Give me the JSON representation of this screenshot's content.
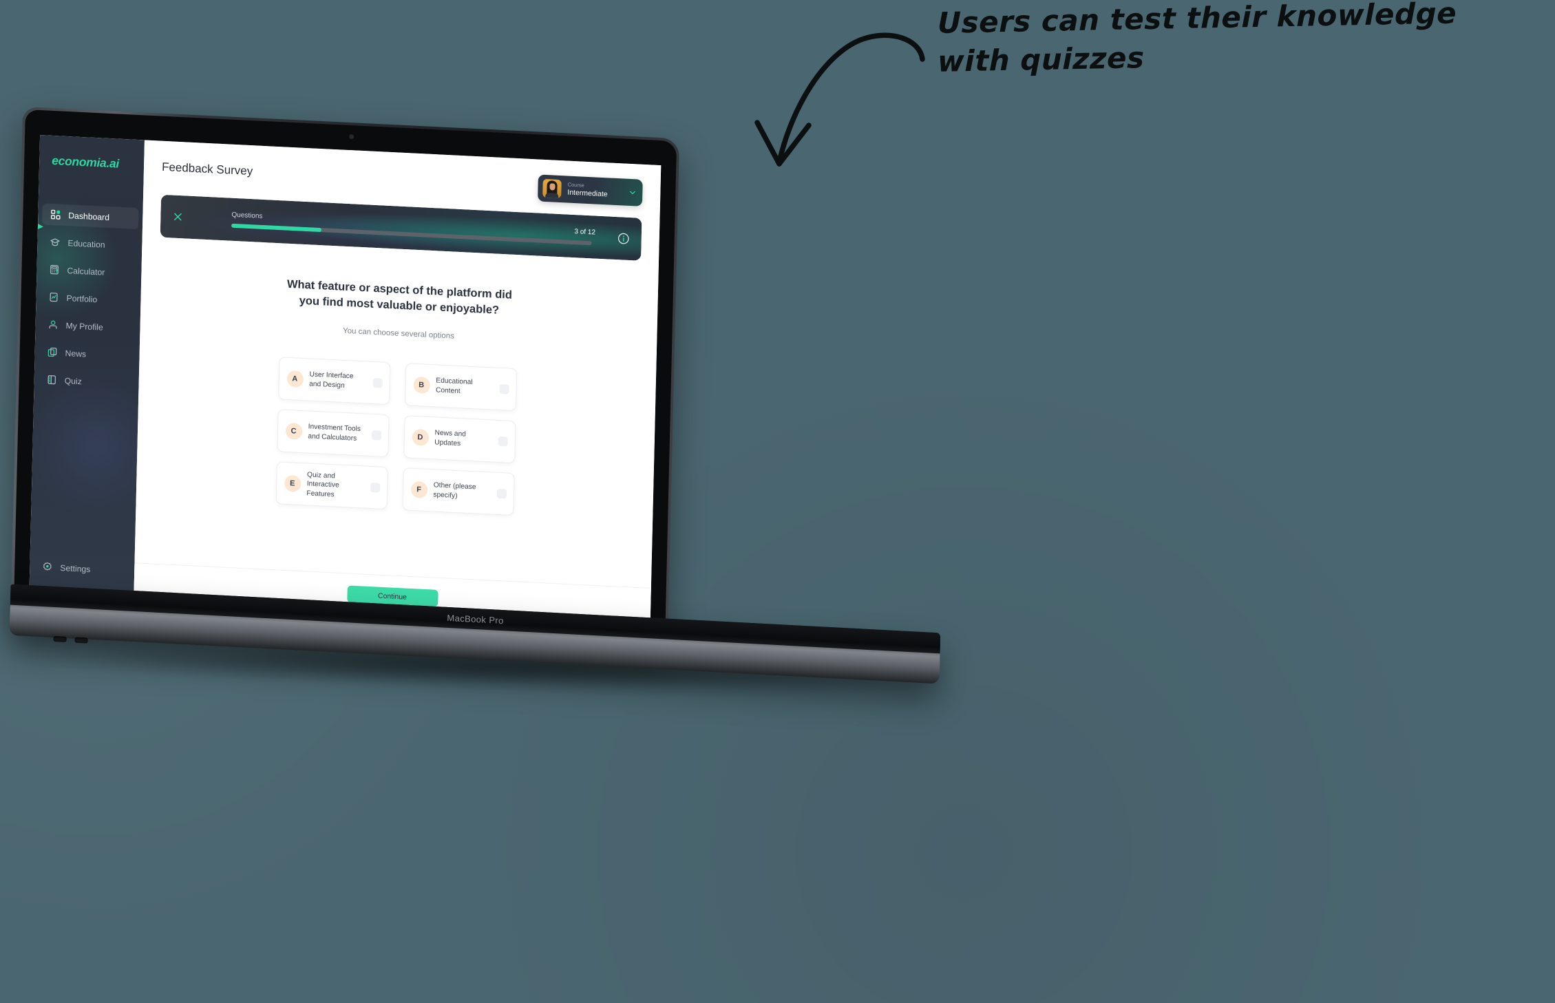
{
  "annotation": {
    "line1": "Users can test their knowledge",
    "line2": "with quizzes",
    "arrow_icon": "curved-down-arrow-icon"
  },
  "device": {
    "label": "MacBook Pro"
  },
  "colors": {
    "background": "#4a6670",
    "accent_green": "#2ed6a0",
    "button_green": "#3ddba8",
    "sidebar_dark": "#2b3340",
    "header_dark": "#2b313c",
    "badge_peach": "#fbe7d2",
    "text_dark": "#2b3240",
    "text_muted": "#7a828e"
  },
  "sidebar": {
    "logo": "economia.ai",
    "items": [
      {
        "label": "Dashboard",
        "icon": "grid-icon",
        "active": true
      },
      {
        "label": "Education",
        "icon": "graduation-cap-icon",
        "active": false
      },
      {
        "label": "Calculator",
        "icon": "calculator-icon",
        "active": false
      },
      {
        "label": "Portfolio",
        "icon": "chart-document-icon",
        "active": false
      },
      {
        "label": "My Profile",
        "icon": "user-icon",
        "active": false
      },
      {
        "label": "News",
        "icon": "copy-pages-icon",
        "active": false
      },
      {
        "label": "Quiz",
        "icon": "book-panel-icon",
        "active": false
      }
    ],
    "bottom": {
      "label": "Settings",
      "icon": "gear-icon"
    }
  },
  "header": {
    "page_title": "Feedback Survey",
    "course_selector": {
      "label": "Course",
      "value": "Intermediate",
      "chevron_icon": "chevron-down-icon",
      "avatar_icon": "user-avatar-photo"
    }
  },
  "quiz_header": {
    "close_icon": "close-x-icon",
    "questions_label": "Questions",
    "counter": "3 of 12",
    "info_icon": "info-circle-icon",
    "progress_percent": 25,
    "current_question": 3,
    "total_questions": 12
  },
  "question": {
    "title": "What feature or aspect of the platform did you find most valuable or enjoyable?",
    "subtitle": "You can choose several options",
    "options": [
      {
        "key": "A",
        "label": "User Interface and Design",
        "checked": false
      },
      {
        "key": "B",
        "label": "Educational Content",
        "checked": false
      },
      {
        "key": "C",
        "label": "Investment Tools and Calculators",
        "checked": false
      },
      {
        "key": "D",
        "label": "News and Updates",
        "checked": false
      },
      {
        "key": "E",
        "label": "Quiz and Interactive Features",
        "checked": false
      },
      {
        "key": "F",
        "label": "Other (please specify)",
        "checked": false
      }
    ]
  },
  "footer": {
    "continue_label": "Continue"
  }
}
